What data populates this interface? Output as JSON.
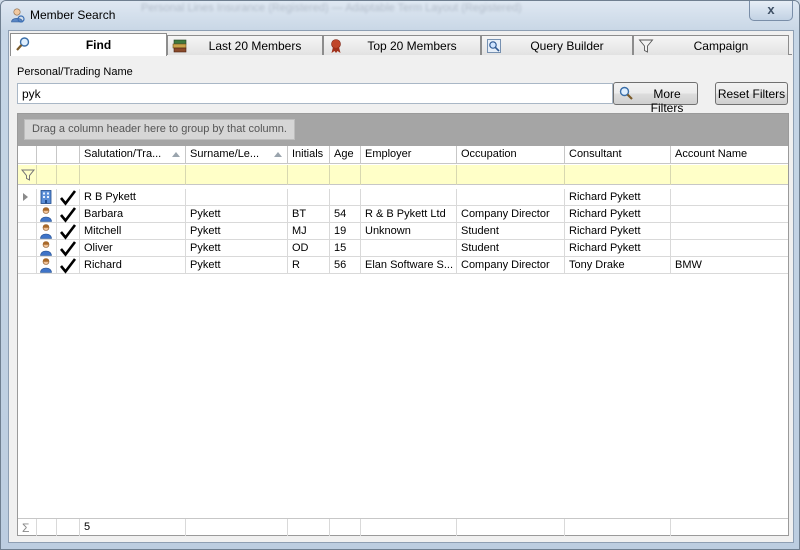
{
  "window": {
    "title": "Member Search",
    "background_text": "Personal Lines Insurance (Registered) — Adaptable Term Layout (Registered)",
    "close_label": "x"
  },
  "tabs": [
    {
      "label": "Find",
      "icon": "magnifier-icon",
      "active": true
    },
    {
      "label": "Last 20 Members",
      "icon": "books-icon",
      "active": false
    },
    {
      "label": "Top 20 Members",
      "icon": "ribbon-award-icon",
      "active": false
    },
    {
      "label": "Query Builder",
      "icon": "query-builder-icon",
      "active": false
    },
    {
      "label": "Campaign",
      "icon": "funnel-icon",
      "active": false
    }
  ],
  "search": {
    "label": "Personal/Trading Name",
    "value": "pyk",
    "more_filters_label": "More Filters",
    "reset_filters_label": "Reset Filters"
  },
  "grid": {
    "group_hint": "Drag a column header here to group by that column.",
    "columns": [
      "Salutation/Tra...",
      "Surname/Le...",
      "Initials",
      "Age",
      "Employer",
      "Occupation",
      "Consultant",
      "Account Name"
    ],
    "rows": [
      {
        "type": "company",
        "salutation": "R B Pykett",
        "surname": "",
        "initials": "",
        "age": "",
        "employer": "",
        "occupation": "",
        "consultant": "Richard Pykett",
        "account": ""
      },
      {
        "type": "person",
        "salutation": "Barbara",
        "surname": "Pykett",
        "initials": "BT",
        "age": "54",
        "employer": "R & B Pykett Ltd",
        "occupation": "Company Director",
        "consultant": "Richard Pykett",
        "account": ""
      },
      {
        "type": "person",
        "salutation": "Mitchell",
        "surname": "Pykett",
        "initials": "MJ",
        "age": "19",
        "employer": "Unknown",
        "occupation": "Student",
        "consultant": "Richard Pykett",
        "account": ""
      },
      {
        "type": "person",
        "salutation": "Oliver",
        "surname": "Pykett",
        "initials": "OD",
        "age": "15",
        "employer": "",
        "occupation": "Student",
        "consultant": "Richard Pykett",
        "account": ""
      },
      {
        "type": "person",
        "salutation": "Richard",
        "surname": "Pykett",
        "initials": "R",
        "age": "56",
        "employer": "Elan Software S...",
        "occupation": "Company Director",
        "consultant": "Tony Drake",
        "account": "BMW"
      }
    ],
    "footer_count": "5"
  }
}
